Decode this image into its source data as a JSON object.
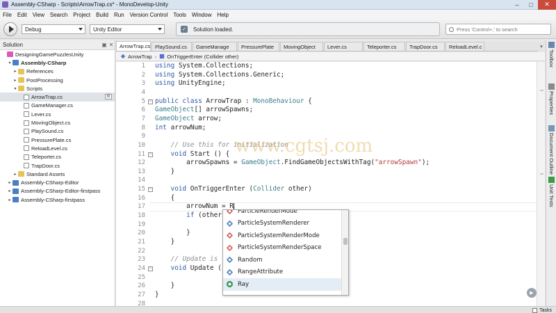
{
  "window": {
    "title": "Assembly-CSharp - Scripts\\ArrowTrap.cs* - MonoDevelop-Unity"
  },
  "menu": [
    "File",
    "Edit",
    "View",
    "Search",
    "Project",
    "Build",
    "Run",
    "Version Control",
    "Tools",
    "Window",
    "Help"
  ],
  "toolbar": {
    "configuration": "Debug",
    "target": "Unity Editor",
    "status": "Solution loaded.",
    "search_placeholder": "Press 'Control+,' to search"
  },
  "solution_panel": {
    "title": "Solution",
    "tree": [
      {
        "label": "DesigningGamePuzzlesUnity",
        "icon": "solution-icon",
        "expander": "",
        "indent": 0,
        "bold": false
      },
      {
        "label": "Assembly-CSharp",
        "icon": "project-icon",
        "expander": "▾",
        "indent": 1,
        "bold": true
      },
      {
        "label": "References",
        "icon": "folder-icon",
        "expander": "▸",
        "indent": 2,
        "bold": false
      },
      {
        "label": "PostProcessing",
        "icon": "folder-icon",
        "expander": "▸",
        "indent": 2,
        "bold": false
      },
      {
        "label": "Scripts",
        "icon": "folder-icon",
        "expander": "▾",
        "indent": 2,
        "bold": false
      },
      {
        "label": "ArrowTrap.cs",
        "icon": "file-icon",
        "expander": "",
        "indent": 3,
        "bold": false,
        "selected": true
      },
      {
        "label": "GameManager.cs",
        "icon": "file-icon",
        "expander": "",
        "indent": 3,
        "bold": false
      },
      {
        "label": "Lever.cs",
        "icon": "file-icon",
        "expander": "",
        "indent": 3,
        "bold": false
      },
      {
        "label": "MovingObject.cs",
        "icon": "file-icon",
        "expander": "",
        "indent": 3,
        "bold": false
      },
      {
        "label": "PlaySound.cs",
        "icon": "file-icon",
        "expander": "",
        "indent": 3,
        "bold": false
      },
      {
        "label": "PressurePlate.cs",
        "icon": "file-icon",
        "expander": "",
        "indent": 3,
        "bold": false
      },
      {
        "label": "ReloadLevel.cs",
        "icon": "file-icon",
        "expander": "",
        "indent": 3,
        "bold": false
      },
      {
        "label": "Teleporter.cs",
        "icon": "file-icon",
        "expander": "",
        "indent": 3,
        "bold": false
      },
      {
        "label": "TrapDoor.cs",
        "icon": "file-icon",
        "expander": "",
        "indent": 3,
        "bold": false
      },
      {
        "label": "Standard Assets",
        "icon": "folder-icon",
        "expander": "▸",
        "indent": 2,
        "bold": false
      },
      {
        "label": "Assembly-CSharp-Editor",
        "icon": "project-icon",
        "expander": "▸",
        "indent": 1,
        "bold": false
      },
      {
        "label": "Assembly-CSharp-Editor-firstpass",
        "icon": "project-icon",
        "expander": "▸",
        "indent": 1,
        "bold": false
      },
      {
        "label": "Assembly-CSharp-firstpass",
        "icon": "project-icon",
        "expander": "▸",
        "indent": 1,
        "bold": false
      }
    ]
  },
  "tabs": [
    {
      "label": "ArrowTrap.cs",
      "active": true
    },
    {
      "label": "PlaySound.cs",
      "active": false
    },
    {
      "label": "GameManage",
      "active": false
    },
    {
      "label": "PressurePlate",
      "active": false
    },
    {
      "label": "MovingObject",
      "active": false
    },
    {
      "label": "Lever.cs",
      "active": false
    },
    {
      "label": "Teleporter.cs",
      "active": false
    },
    {
      "label": "TrapDoor.cs",
      "active": false
    },
    {
      "label": "ReloadLevel.c",
      "active": false
    }
  ],
  "breadcrumb": {
    "class": "ArrowTrap",
    "member": "OnTriggerEnter (Collider other)"
  },
  "code": {
    "lines": [
      {
        "n": "1",
        "text": "using System.Collections;"
      },
      {
        "n": "2",
        "text": "using System.Collections.Generic;"
      },
      {
        "n": "3",
        "text": "using UnityEngine;"
      },
      {
        "n": "4",
        "text": ""
      },
      {
        "n": "5",
        "text": "public class ArrowTrap : MonoBehaviour {"
      },
      {
        "n": "6",
        "text": "GameObject[] arrowSpawns;"
      },
      {
        "n": "7",
        "text": "GameObject arrow;"
      },
      {
        "n": "8",
        "text": "int arrowNum;"
      },
      {
        "n": "9",
        "text": ""
      },
      {
        "n": "10",
        "text": "    // Use this for initialization"
      },
      {
        "n": "11",
        "text": "    void Start () {"
      },
      {
        "n": "12",
        "text": "        arrowSpawns = GameObject.FindGameObjectsWithTag(\"arrowSpawn\");"
      },
      {
        "n": "13",
        "text": "    }"
      },
      {
        "n": "14",
        "text": ""
      },
      {
        "n": "15",
        "text": "    void OnTriggerEnter (Collider other)"
      },
      {
        "n": "16",
        "text": "    {"
      },
      {
        "n": "17",
        "text": "        arrowNum = R"
      },
      {
        "n": "18",
        "text": "        if (other"
      },
      {
        "n": "19",
        "text": ""
      },
      {
        "n": "20",
        "text": "        }"
      },
      {
        "n": "21",
        "text": "    }"
      },
      {
        "n": "22",
        "text": ""
      },
      {
        "n": "23",
        "text": "    // Update is"
      },
      {
        "n": "24",
        "text": "    void Update ("
      },
      {
        "n": "25",
        "text": ""
      },
      {
        "n": "26",
        "text": "    }"
      },
      {
        "n": "27",
        "text": "}"
      },
      {
        "n": "28",
        "text": ""
      }
    ]
  },
  "completion": {
    "items": [
      {
        "label": "ParticleRenderMode",
        "icon": "enum-icon"
      },
      {
        "label": "ParticleSystemRenderer",
        "icon": "class-icon"
      },
      {
        "label": "ParticleSystemRenderMode",
        "icon": "enum-icon"
      },
      {
        "label": "ParticleSystemRenderSpace",
        "icon": "enum-icon"
      },
      {
        "label": "Random",
        "icon": "class-icon"
      },
      {
        "label": "RangeAttribute",
        "icon": "class-icon"
      },
      {
        "label": "Ray",
        "icon": "struct-icon",
        "selected": true
      }
    ]
  },
  "right_pads": [
    {
      "label": "Toolbox",
      "icon": "toolbox-icon"
    },
    {
      "label": "Properties",
      "icon": "properties-icon"
    },
    {
      "label": "Document Outline",
      "icon": "outline-icon"
    },
    {
      "label": "Unit Tests",
      "icon": "unit-tests-icon"
    }
  ],
  "statusbar": {
    "tasks_label": "Tasks"
  },
  "watermark": {
    "text": "www.cgtsj.com"
  },
  "colors": {
    "keyword": "#2e58a8",
    "type": "#3b7c8c",
    "string": "#b13a3a",
    "comment": "#8a8f98",
    "selection": "#e4ecf6"
  }
}
